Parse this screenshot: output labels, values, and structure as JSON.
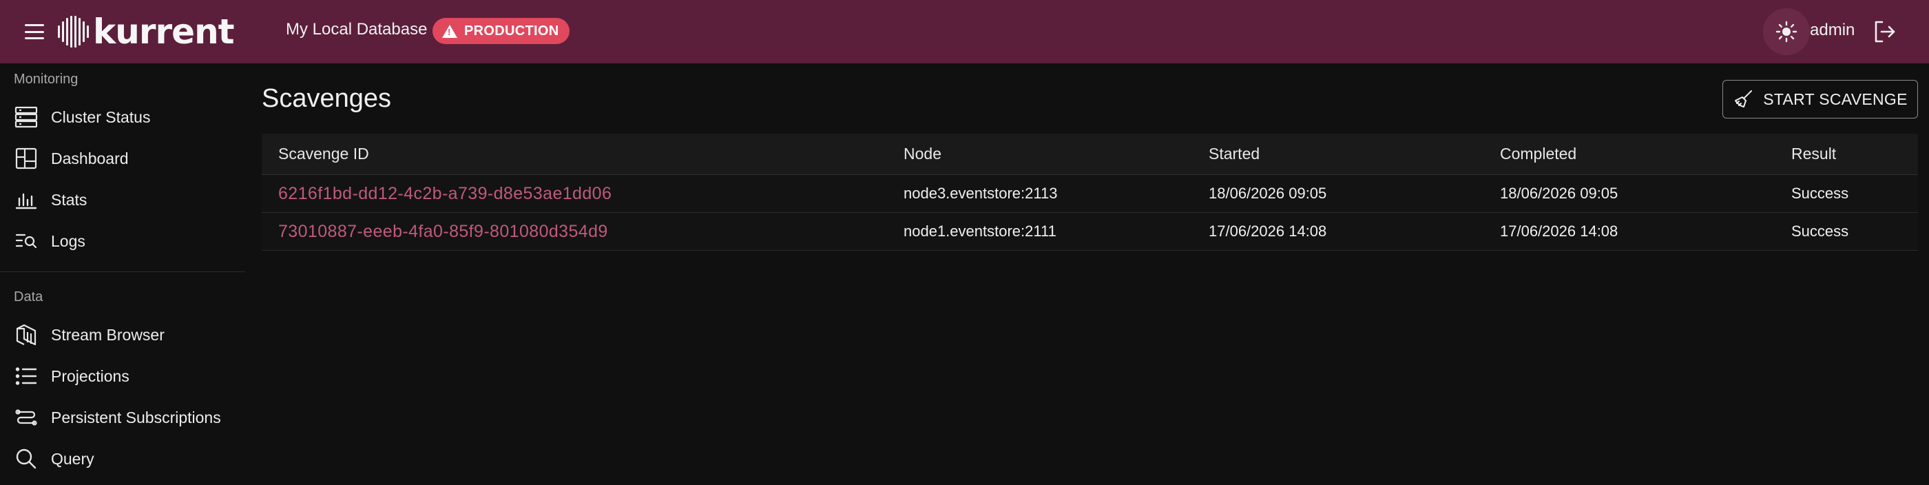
{
  "header": {
    "brand": "kurrent",
    "database_name": "My Local Database",
    "environment_badge": "PRODUCTION",
    "user": "admin",
    "colors": {
      "header_bg": "#5c1f3b",
      "badge_bg": "#e0485e",
      "link": "#c0597e"
    }
  },
  "sidebar": {
    "sections": [
      {
        "label": "Monitoring",
        "items": [
          {
            "label": "Cluster Status",
            "icon": "server-icon"
          },
          {
            "label": "Dashboard",
            "icon": "dashboard-icon"
          },
          {
            "label": "Stats",
            "icon": "bar-chart-icon"
          },
          {
            "label": "Logs",
            "icon": "log-search-icon"
          }
        ]
      },
      {
        "label": "Data",
        "items": [
          {
            "label": "Stream Browser",
            "icon": "stream-icon"
          },
          {
            "label": "Projections",
            "icon": "list-icon"
          },
          {
            "label": "Persistent Subscriptions",
            "icon": "subscriptions-icon"
          },
          {
            "label": "Query",
            "icon": "search-icon"
          }
        ]
      }
    ]
  },
  "main": {
    "title": "Scavenges",
    "start_button": "START SCAVENGE",
    "table": {
      "columns": [
        "Scavenge ID",
        "Node",
        "Started",
        "Completed",
        "Result"
      ],
      "rows": [
        {
          "id": "6216f1bd-dd12-4c2b-a739-d8e53ae1dd06",
          "node": "node3.eventstore:2113",
          "started": "18/06/2026 09:05",
          "completed": "18/06/2026 09:05",
          "result": "Success"
        },
        {
          "id": "73010887-eeeb-4fa0-85f9-801080d354d9",
          "node": "node1.eventstore:2111",
          "started": "17/06/2026 14:08",
          "completed": "17/06/2026 14:08",
          "result": "Success"
        }
      ]
    }
  }
}
